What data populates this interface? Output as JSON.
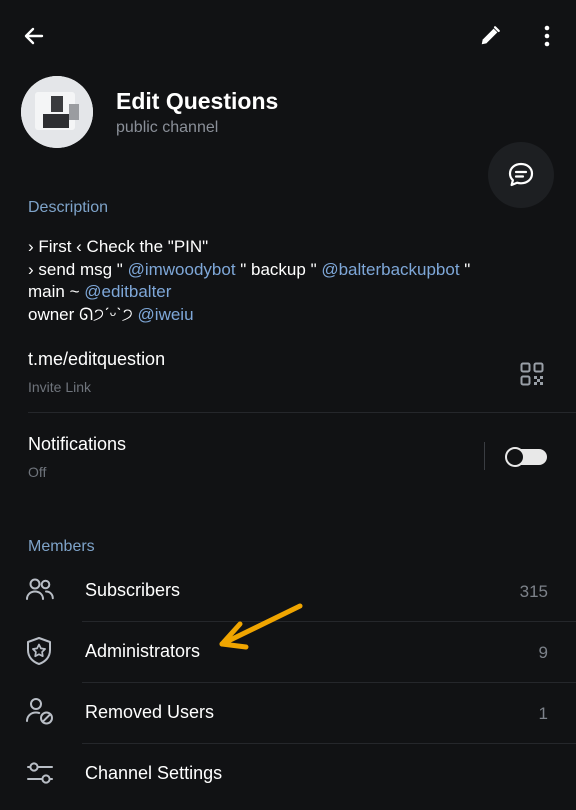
{
  "header": {
    "back_icon": "arrow-left-icon",
    "edit_icon": "pencil-icon",
    "more_icon": "vertical-dots-icon"
  },
  "channel": {
    "name": "Edit Questions",
    "type": "public channel"
  },
  "description": {
    "label": "Description",
    "line1": "› First ‹ Check the \"PIN\"",
    "line2_prefix": "› send msg \" ",
    "line2_mention1": "@imwoodybot",
    "line2_mid": " \"   backup \" ",
    "line2_mention2": "@balterbackupbot",
    "line2_suffix": " \"",
    "line3_prefix": "main ~ ",
    "line3_mention": "@editbalter",
    "line4_prefix": "owner ᘏ੭ˊᵕˋ੭ ",
    "line4_mention": "@iweiu"
  },
  "invite": {
    "link": "t.me/editquestion",
    "label": "Invite Link"
  },
  "notifications": {
    "title": "Notifications",
    "status": "Off",
    "enabled": false
  },
  "members": {
    "label": "Members",
    "items": [
      {
        "label": "Subscribers",
        "count": "315",
        "icon": "people-icon"
      },
      {
        "label": "Administrators",
        "count": "9",
        "icon": "shield-star-icon"
      },
      {
        "label": "Removed Users",
        "count": "1",
        "icon": "user-blocked-icon"
      },
      {
        "label": "Channel Settings",
        "count": "",
        "icon": "sliders-icon"
      }
    ]
  },
  "colors": {
    "background": "#111214",
    "accent": "#7ea3c9",
    "mention": "#7ea7d8",
    "annotation_arrow": "#f0a500"
  }
}
